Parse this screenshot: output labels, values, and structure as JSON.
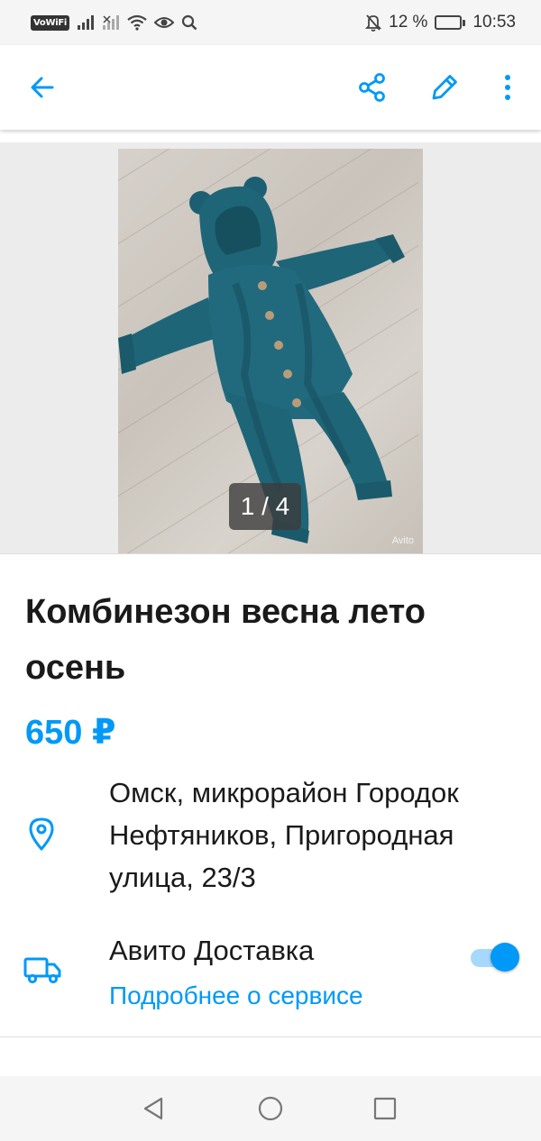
{
  "status_bar": {
    "vowifi": "VoWiFi",
    "battery_percent": "12 %",
    "time": "10:53",
    "battery_level": 0.12
  },
  "toolbar": {
    "icons": [
      "back-arrow-icon",
      "share-icon",
      "edit-pencil-icon",
      "more-vert-icon"
    ],
    "accent_color": "#0099f7"
  },
  "gallery": {
    "counter": "1 / 4",
    "watermark": "Avito"
  },
  "listing": {
    "title": "Комбинезон весна лето осень",
    "price": "650 ₽",
    "address": "Омск, микрорайон Городок Нефтяников, Пригородная улица, 23/3"
  },
  "delivery": {
    "title": "Авито Доставка",
    "link": "Подробнее о сервисе",
    "enabled": true
  },
  "nav_bar": {
    "icons": [
      "back-triangle-icon",
      "home-circle-icon",
      "recents-square-icon"
    ]
  }
}
